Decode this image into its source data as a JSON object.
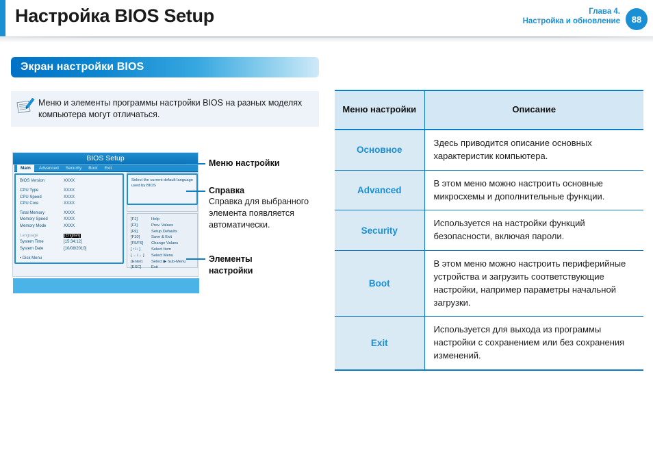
{
  "header": {
    "title": "Настройка BIOS Setup",
    "chapter": "Глава 4.",
    "chapter_name": "Настройка и обновление",
    "page_number": "88",
    "accent_color": "#1a8fd4"
  },
  "section": {
    "title": "Экран настройки BIOS"
  },
  "note": {
    "icon": "note-pencil-icon",
    "text": "Меню и элементы программы настройки BIOS на разных моделях компьютера могут отличаться."
  },
  "bios_figure": {
    "screen_title": "BIOS Setup",
    "tabs": [
      {
        "label": "Main",
        "active": true
      },
      {
        "label": "Advanced",
        "active": false
      },
      {
        "label": "Security",
        "active": false
      },
      {
        "label": "Boot",
        "active": false
      },
      {
        "label": "Exit",
        "active": false
      }
    ],
    "items": [
      {
        "label": "BIOS Version",
        "value": "XXXX",
        "dim": false,
        "inverted": false
      },
      {
        "label": "CPU Type",
        "value": "XXXX",
        "dim": false,
        "inverted": false
      },
      {
        "label": "CPU Speed",
        "value": "XXXX",
        "dim": false,
        "inverted": false
      },
      {
        "label": "CPU Core",
        "value": "XXXX",
        "dim": false,
        "inverted": false
      },
      {
        "label": "Total Memory",
        "value": "XXXX",
        "dim": false,
        "inverted": false
      },
      {
        "label": "Memory Speed",
        "value": "XXXX",
        "dim": false,
        "inverted": false
      },
      {
        "label": "Memory Mode",
        "value": "XXXX",
        "dim": false,
        "inverted": false
      },
      {
        "label": "Language",
        "value": "[English]",
        "dim": true,
        "inverted": true
      },
      {
        "label": "System Time",
        "value": "[15:34:12]",
        "dim": false,
        "inverted": false
      },
      {
        "label": "System Date",
        "value": "[10/08/2010]",
        "dim": false,
        "inverted": false
      },
      {
        "label": "Disk Menu",
        "value": "",
        "dim": false,
        "inverted": false
      }
    ],
    "help_text": "Select the current default language used by BIOS",
    "keys": [
      {
        "key": "[F1]",
        "action": "Help"
      },
      {
        "key": "[F3]",
        "action": "Prev. Values"
      },
      {
        "key": "[F9]",
        "action": "Setup Defaults"
      },
      {
        "key": "[F10]",
        "action": "Save & Exit"
      },
      {
        "key": "[F5/F6]",
        "action": "Change Values"
      },
      {
        "key": "[ ↑/↓ ]",
        "action": "Select Item"
      },
      {
        "key": "[ ←/→ ]",
        "action": "Select Menu"
      },
      {
        "key": "[Enter]",
        "action": "Select ▶ Sub-Menu"
      },
      {
        "key": "[ESC]",
        "action": "Exit"
      }
    ]
  },
  "callouts": [
    {
      "title": "Меню настройки",
      "body": ""
    },
    {
      "title": "Справка",
      "body": "Справка для выбранного элемента появляется автоматически."
    },
    {
      "title": "Элементы настройки",
      "body": ""
    }
  ],
  "table": {
    "headers": [
      "Меню настройки",
      "Описание"
    ],
    "rows": [
      {
        "menu": "Основное",
        "description": "Здесь приводится описание основных характеристик компьютера."
      },
      {
        "menu": "Advanced",
        "description": "В этом меню можно настроить основные микросхемы и дополнительные функции."
      },
      {
        "menu": "Security",
        "description": "Используется на настройки функций безопасности, включая пароли."
      },
      {
        "menu": "Boot",
        "description": "В этом меню можно настроить периферийные устройства и загрузить соответствующие настройки, например параметры начальной загрузки."
      },
      {
        "menu": "Exit",
        "description": "Используется для выхода из программы настройки с сохранением или без сохранения изменений."
      }
    ]
  }
}
